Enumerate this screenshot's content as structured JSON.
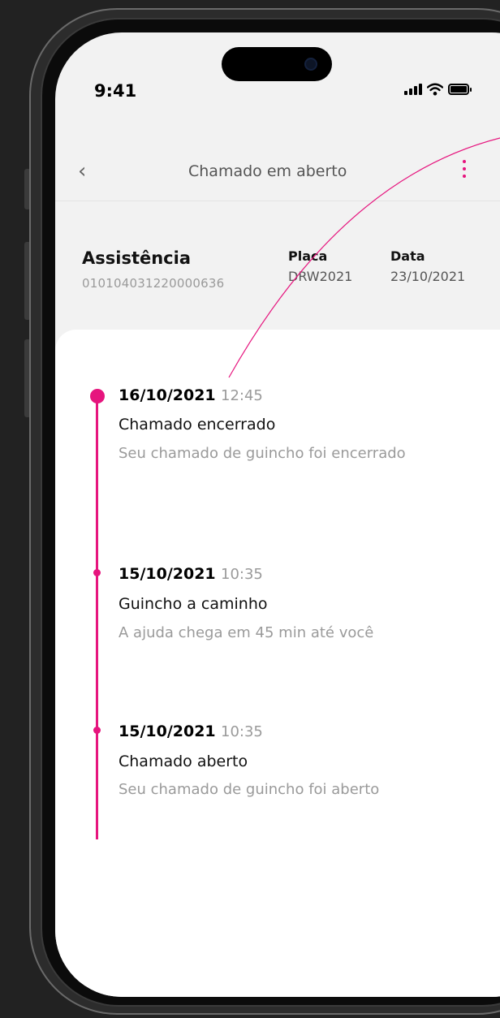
{
  "status_bar": {
    "time": "9:41"
  },
  "header": {
    "title": "Chamado em aberto"
  },
  "info": {
    "service_label": "Assistência",
    "service_id": "010104031220000636",
    "plate_label": "Placa",
    "plate_value": "DRW2021",
    "date_label": "Data",
    "date_value": "23/10/2021"
  },
  "timeline": [
    {
      "date": "16/10/2021",
      "time": "12:45",
      "title": "Chamado encerrado",
      "description": "Seu chamado de guincho foi encerrado"
    },
    {
      "date": "15/10/2021",
      "time": "10:35",
      "title": "Guincho a caminho",
      "description": "A ajuda chega em 45 min até você"
    },
    {
      "date": "15/10/2021",
      "time": "10:35",
      "title": "Chamado aberto",
      "description": "Seu chamado de guincho foi aberto"
    }
  ],
  "colors": {
    "accent": "#e6157e",
    "background": "#222222",
    "screen": "#f2f2f2",
    "card": "#ffffff"
  },
  "icons": [
    "back-chevron-icon",
    "more-vertical-icon",
    "signal-icon",
    "wifi-icon",
    "battery-icon"
  ]
}
